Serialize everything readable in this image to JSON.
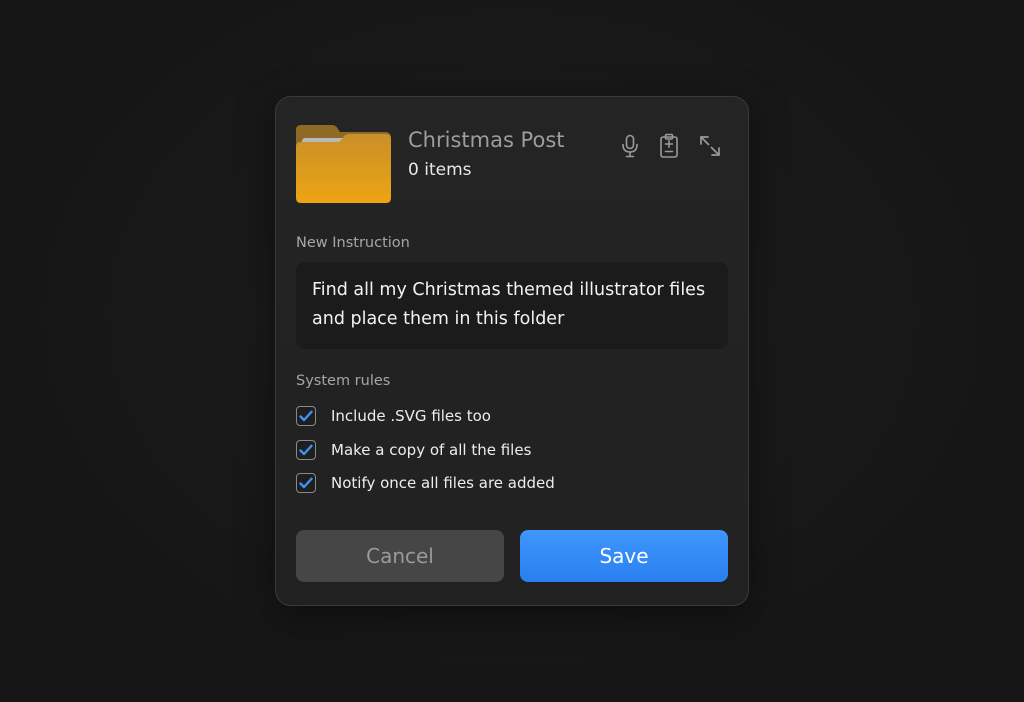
{
  "folder": {
    "title": "Christmas Post",
    "count_text": "0 items"
  },
  "header_icons": [
    "microphone-icon",
    "clipboard-icon",
    "expand-icon"
  ],
  "instruction": {
    "label": "New Instruction",
    "text": "Find all my Christmas themed illustrator files and place them in this folder"
  },
  "rules": {
    "label": "System rules",
    "items": [
      {
        "label": "Include .SVG files too",
        "checked": true
      },
      {
        "label": "Make a copy of all the files",
        "checked": true
      },
      {
        "label": "Notify once all files are added",
        "checked": true
      }
    ]
  },
  "actions": {
    "cancel_label": "Cancel",
    "save_label": "Save"
  },
  "colors": {
    "background": "#171717",
    "dialog": "#232323",
    "accent": "#2f86f6",
    "folder": "#e8a317",
    "check": "#3b93f8"
  }
}
